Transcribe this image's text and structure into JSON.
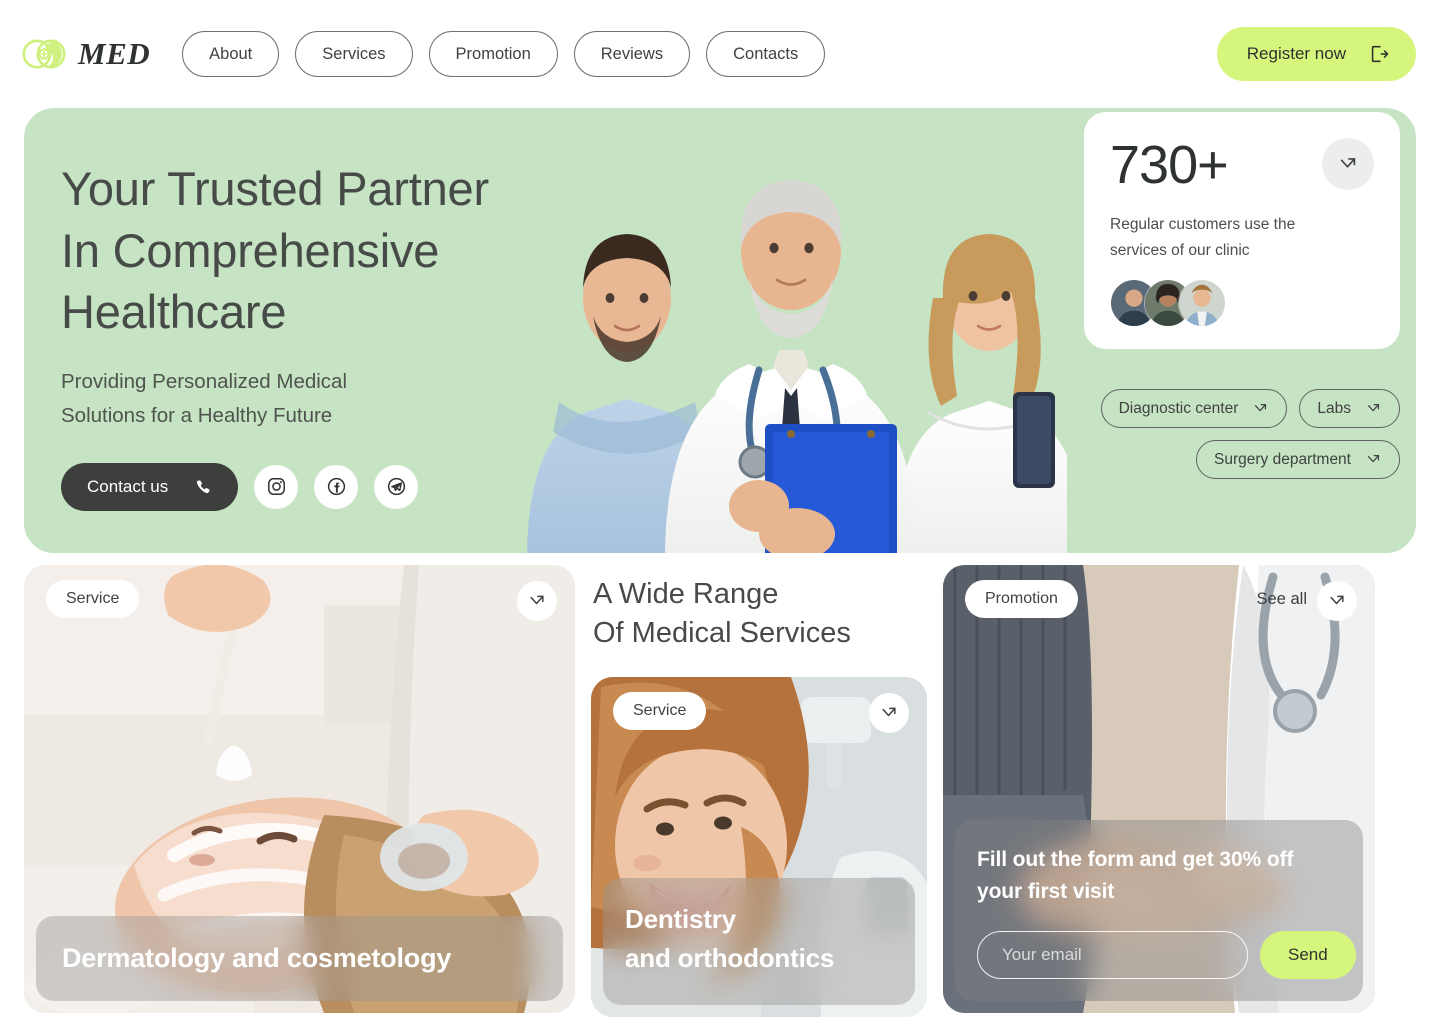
{
  "brand": {
    "name": "MED",
    "logo_icon": "leaf-circles-plus-icon",
    "accent": "#d6f57d",
    "hero_bg": "#c6e3c3"
  },
  "header": {
    "nav": [
      {
        "label": "About"
      },
      {
        "label": "Services"
      },
      {
        "label": "Promotion"
      },
      {
        "label": "Reviews"
      },
      {
        "label": "Contacts"
      }
    ],
    "register": {
      "label": "Register now",
      "icon": "sign-out-arrow-icon"
    }
  },
  "hero": {
    "title_line1": "Your Trusted Partner",
    "title_line2": "In Comprehensive",
    "title_line3": "Healthcare",
    "subtitle_line1": "Providing Personalized Medical",
    "subtitle_line2": "Solutions for a Healthy Future",
    "contact_button": {
      "label": "Contact us",
      "icon": "phone-icon"
    },
    "socials": [
      {
        "name": "instagram-icon"
      },
      {
        "name": "facebook-icon"
      },
      {
        "name": "telegram-icon"
      }
    ],
    "stat": {
      "number": "730+",
      "description_line1": "Regular customers use the",
      "description_line2": "services of our clinic",
      "arrow_icon": "arrow-up-right-icon",
      "avatar_count": 3
    },
    "tags": [
      {
        "label": "Diagnostic center",
        "icon": "arrow-up-right-icon"
      },
      {
        "label": "Labs",
        "icon": "arrow-up-right-icon"
      },
      {
        "label": "Surgery department",
        "icon": "arrow-up-right-icon"
      }
    ]
  },
  "services": {
    "heading_line1": "A Wide Range",
    "heading_line2": "Of Medical Services",
    "dermatology": {
      "badge": "Service",
      "caption": "Dermatology and cosmetology",
      "arrow_icon": "arrow-up-right-icon"
    },
    "dentistry": {
      "badge": "Service",
      "caption_line1": "Dentistry",
      "caption_line2": "and orthodontics",
      "arrow_icon": "arrow-up-right-icon"
    }
  },
  "promotion": {
    "badge": "Promotion",
    "see_all": "See all",
    "arrow_icon": "arrow-up-right-icon",
    "title_line1": "Fill out the form and get 30% off",
    "title_line2": "your first visit",
    "email_placeholder": "Your email",
    "email_value": "",
    "send_label": "Send"
  }
}
